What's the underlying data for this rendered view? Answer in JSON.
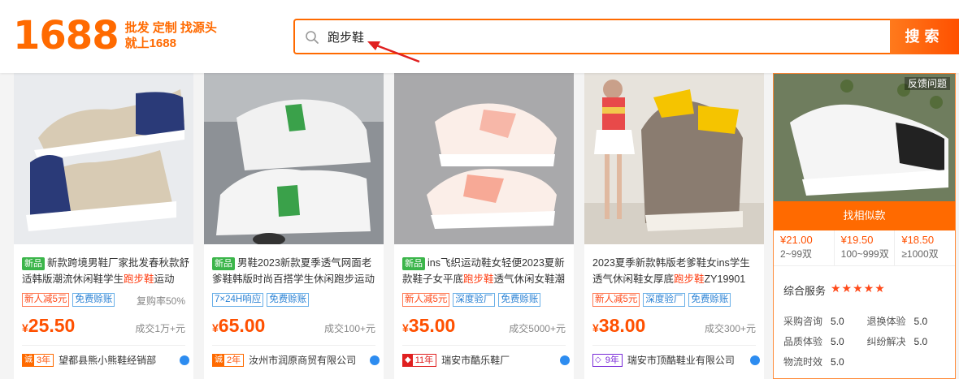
{
  "header": {
    "logo_number": "1688",
    "logo_line1": "批发 定制 找源头",
    "logo_line2": "就上1688",
    "search_value": "跑步鞋",
    "search_button": "搜索"
  },
  "products": [
    {
      "new_badge": "新品",
      "title_pre": "新款跨境男鞋厂家批发春秋款舒适韩版潮流休闲鞋学生",
      "title_hl": "跑步鞋",
      "title_post": "运动",
      "tags": [
        "新人减5元",
        "免费赊账"
      ],
      "repurchase": "复购率50%",
      "currency": "¥",
      "price": "25.50",
      "sold": "成交1万+元",
      "years": "3年",
      "seller": "望都县熊小熊鞋经销部"
    },
    {
      "new_badge": "新品",
      "title_pre": "男鞋2023新款夏季透气网面老爹鞋韩版时尚百搭学生休闲跑步运动",
      "title_hl": "",
      "title_post": "",
      "tags": [
        "7×24H响应",
        "免费赊账"
      ],
      "repurchase": "",
      "currency": "¥",
      "price": "65.00",
      "sold": "成交100+元",
      "years": "2年",
      "seller": "汝州市润原商贸有限公司"
    },
    {
      "new_badge": "新品",
      "title_pre": "ins飞织运动鞋女轻便2023夏新款鞋子女平底",
      "title_hl": "跑步鞋",
      "title_post": "透气休闲女鞋潮",
      "tags": [
        "新人减5元",
        "深度验厂",
        "免费赊账"
      ],
      "repurchase": "",
      "currency": "¥",
      "price": "35.00",
      "sold": "成交5000+元",
      "years": "11年",
      "seller": "瑞安市酷乐鞋厂"
    },
    {
      "new_badge": "",
      "title_pre": "2023夏季新款韩版老爹鞋女ins学生透气休闲鞋女厚底",
      "title_hl": "跑步鞋",
      "title_post": "ZY19901",
      "tags": [
        "新人减5元",
        "深度验厂",
        "免费赊账"
      ],
      "repurchase": "",
      "currency": "¥",
      "price": "38.00",
      "sold": "成交300+元",
      "years": "9年",
      "seller": "瑞安市顶酷鞋业有限公司"
    }
  ],
  "side_panel": {
    "feedback": "反馈问题",
    "similar_button": "找相似款",
    "tiers": [
      {
        "price": "¥21.00",
        "qty": "2~99双"
      },
      {
        "price": "¥19.50",
        "qty": "100~999双"
      },
      {
        "price": "¥18.50",
        "qty": "≥1000双"
      }
    ],
    "service_title": "综合服务",
    "stars": "★★★★★",
    "metrics": [
      {
        "label": "采购咨询",
        "value": "5.0"
      },
      {
        "label": "退换体验",
        "value": "5.0"
      },
      {
        "label": "品质体验",
        "value": "5.0"
      },
      {
        "label": "纠纷解决",
        "value": "5.0"
      },
      {
        "label": "物流时效",
        "value": "5.0"
      }
    ]
  },
  "colors": {
    "accent": "#ff6a00",
    "price": "#ff5000",
    "new_badge": "#3bb54a"
  }
}
